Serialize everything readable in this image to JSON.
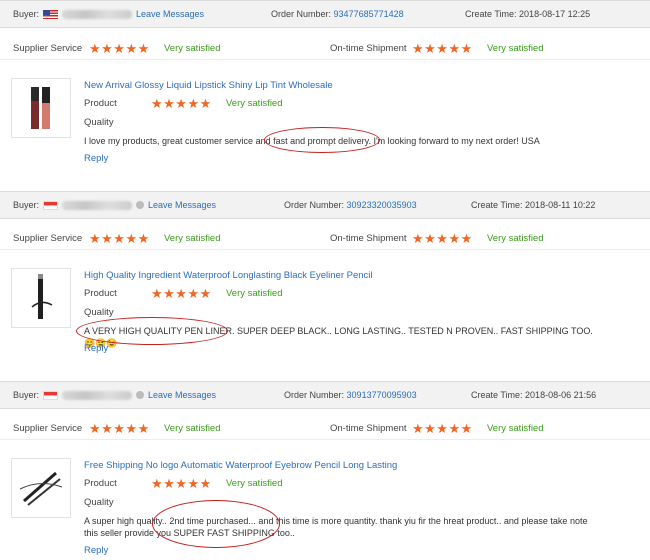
{
  "reviews": [
    {
      "buyer_label": "Buyer:",
      "flag": "us",
      "leave_messages": "Leave Messages",
      "order_label": "Order Number:",
      "order_number": "93477685771428",
      "create_label": "Create Time:",
      "create_time": "2018-08-17 12:25",
      "supplier_service_label": "Supplier Service",
      "supplier_service_stars": 5,
      "supplier_service_text": "Very satisfied",
      "ontime_label": "On-time Shipment",
      "ontime_stars": 5,
      "ontime_text": "Very satisfied",
      "product_title": "New Arrival Glossy Liquid Lipstick Shiny Lip Tint Wholesale",
      "product_label": "Product",
      "product_stars": 5,
      "product_text": "Very satisfied",
      "quality_label": "Quality",
      "comment": "I love my products, great customer service and fast and prompt delivery. I'm looking forward to my next order! USA",
      "reply": "Reply"
    },
    {
      "buyer_label": "Buyer:",
      "flag": "sg",
      "leave_messages": "Leave Messages",
      "order_label": "Order Number:",
      "order_number": "30923320035903",
      "create_label": "Create Time:",
      "create_time": "2018-08-11 10:22",
      "supplier_service_label": "Supplier Service",
      "supplier_service_stars": 5,
      "supplier_service_text": "Very satisfied",
      "ontime_label": "On-time Shipment",
      "ontime_stars": 5,
      "ontime_text": "Very satisfied",
      "product_title": "High Quality Ingredient Waterproof Longlasting Black Eyeliner Pencil",
      "product_label": "Product",
      "product_stars": 5,
      "product_text": "Very satisfied",
      "quality_label": "Quality",
      "comment": "A VERY HIGH QUALITY PEN LINER. SUPER DEEP BLACK.. LONG LASTING.. TESTED N PROVEN.. FAST SHIPPING TOO. 😊😉😉",
      "reply": "Reply"
    },
    {
      "buyer_label": "Buyer:",
      "flag": "sg",
      "leave_messages": "Leave Messages",
      "order_label": "Order Number:",
      "order_number": "30913770095903",
      "create_label": "Create Time:",
      "create_time": "2018-08-06 21:56",
      "supplier_service_label": "Supplier Service",
      "supplier_service_stars": 5,
      "supplier_service_text": "Very satisfied",
      "ontime_label": "On-time Shipment",
      "ontime_stars": 5,
      "ontime_text": "Very satisfied",
      "product_title": "Free Shipping No logo Automatic Waterproof Eyebrow Pencil Long Lasting",
      "product_label": "Product",
      "product_stars": 5,
      "product_text": "Very satisfied",
      "quality_label": "Quality",
      "comment_line1": "A super high quality.. 2nd time purchased... and this time is more quantity. thank yiu fir the hreat product.. and please take note",
      "comment_line2": "this seller provide you SUPER FAST SHIPPING too..",
      "reply": "Reply"
    }
  ],
  "star_glyph": "★★★★★",
  "colors": {
    "star": "#f26522",
    "satisfied": "#3c9a1e",
    "link": "#2a6ebb",
    "highlight_oval": "#c81e1e"
  }
}
